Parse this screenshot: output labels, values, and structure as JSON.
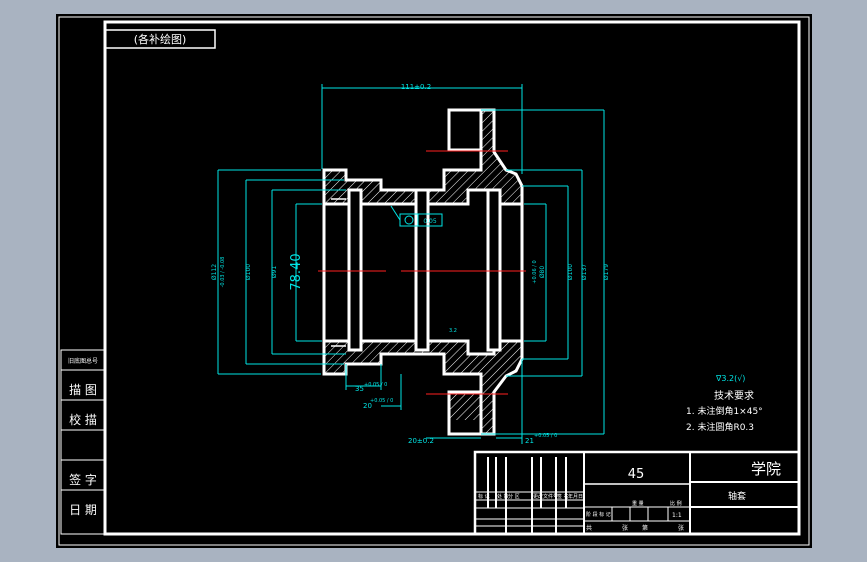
{
  "drawing": {
    "view_label": "(各补绘图)",
    "material": "45",
    "school": "学院",
    "part_name": "轴套",
    "left_strip": [
      "描 图",
      "校 描",
      "签 字",
      "日 期"
    ],
    "left_strip_small": "旧底图总号",
    "table_headers": [
      "标 记",
      "处 数",
      "分 区",
      "更改文件号",
      "签 名",
      "年月日"
    ],
    "stage_labels": [
      "阶 段 标 记",
      "重 量",
      "比 例"
    ],
    "scale": "1:1",
    "sheet_labels": [
      "共",
      "张",
      "第",
      "张"
    ],
    "tech_title": "技术要求",
    "tech_notes": [
      "1. 未注倒角1×45°",
      "2. 未注圆角R0.3"
    ],
    "roughness": "∇3.2(√)",
    "roughness_small": "3.2",
    "dims": {
      "overall_length": "111±0.2",
      "bore_diameter": "78.40",
      "tol_gdt": "0.05",
      "left_d1": "Ø112",
      "left_d1_tol": "-0.03 / -0.08",
      "left_d2": "Ø100",
      "left_d3": "Ø91",
      "right_d1": "Ø80",
      "right_d1_tol": "+0.06 / 0",
      "right_d2": "Ø100",
      "right_d3": "Ø137",
      "right_d4": "Ø179",
      "dim_35": "35",
      "dim_35_tol": "+0.05 / 0",
      "dim_20": "20",
      "dim_20_tol": "+0.05 / 0",
      "dim_20b": "20±0.2",
      "dim_21": "21",
      "dim_21_tol": "+0.05 / 0"
    }
  }
}
